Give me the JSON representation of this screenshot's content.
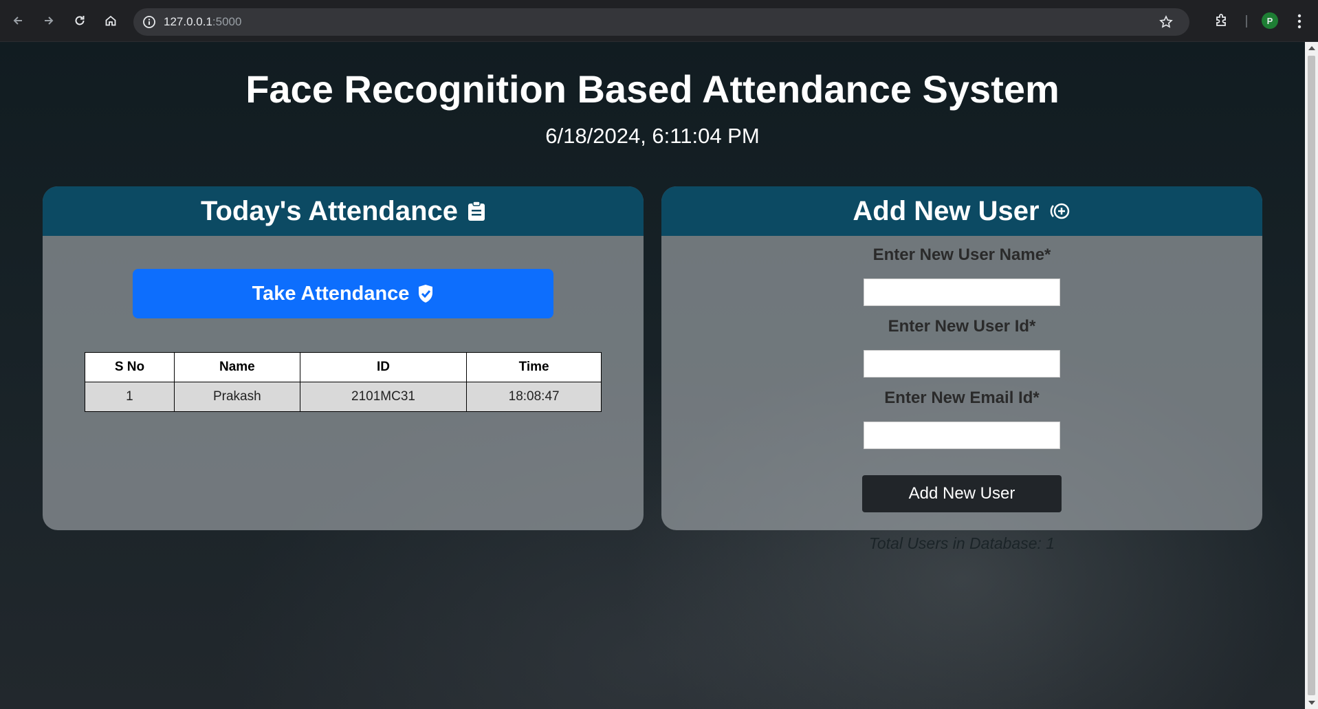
{
  "browser": {
    "url_host": "127.0.0.1",
    "url_port": ":5000",
    "profile_initial": "P"
  },
  "header": {
    "title": "Face Recognition Based Attendance System",
    "datetime": "6/18/2024, 6:11:04 PM"
  },
  "attendance_panel": {
    "title": "Today's Attendance",
    "take_button_label": "Take Attendance",
    "columns": [
      "S No",
      "Name",
      "ID",
      "Time"
    ],
    "rows": [
      {
        "sno": "1",
        "name": "Prakash",
        "id": "2101MC31",
        "time": "18:08:47"
      }
    ]
  },
  "add_user_panel": {
    "title": "Add New User",
    "name_label": "Enter New User Name*",
    "name_value": "",
    "id_label": "Enter New User Id*",
    "id_value": "",
    "email_label": "Enter New Email Id*",
    "email_value": "",
    "submit_label": "Add New User",
    "total_users_text": "Total Users in Database: 1"
  },
  "colors": {
    "panel_header": "#0c4a63",
    "primary_button": "#0d6efd",
    "dark_button": "#212529"
  }
}
